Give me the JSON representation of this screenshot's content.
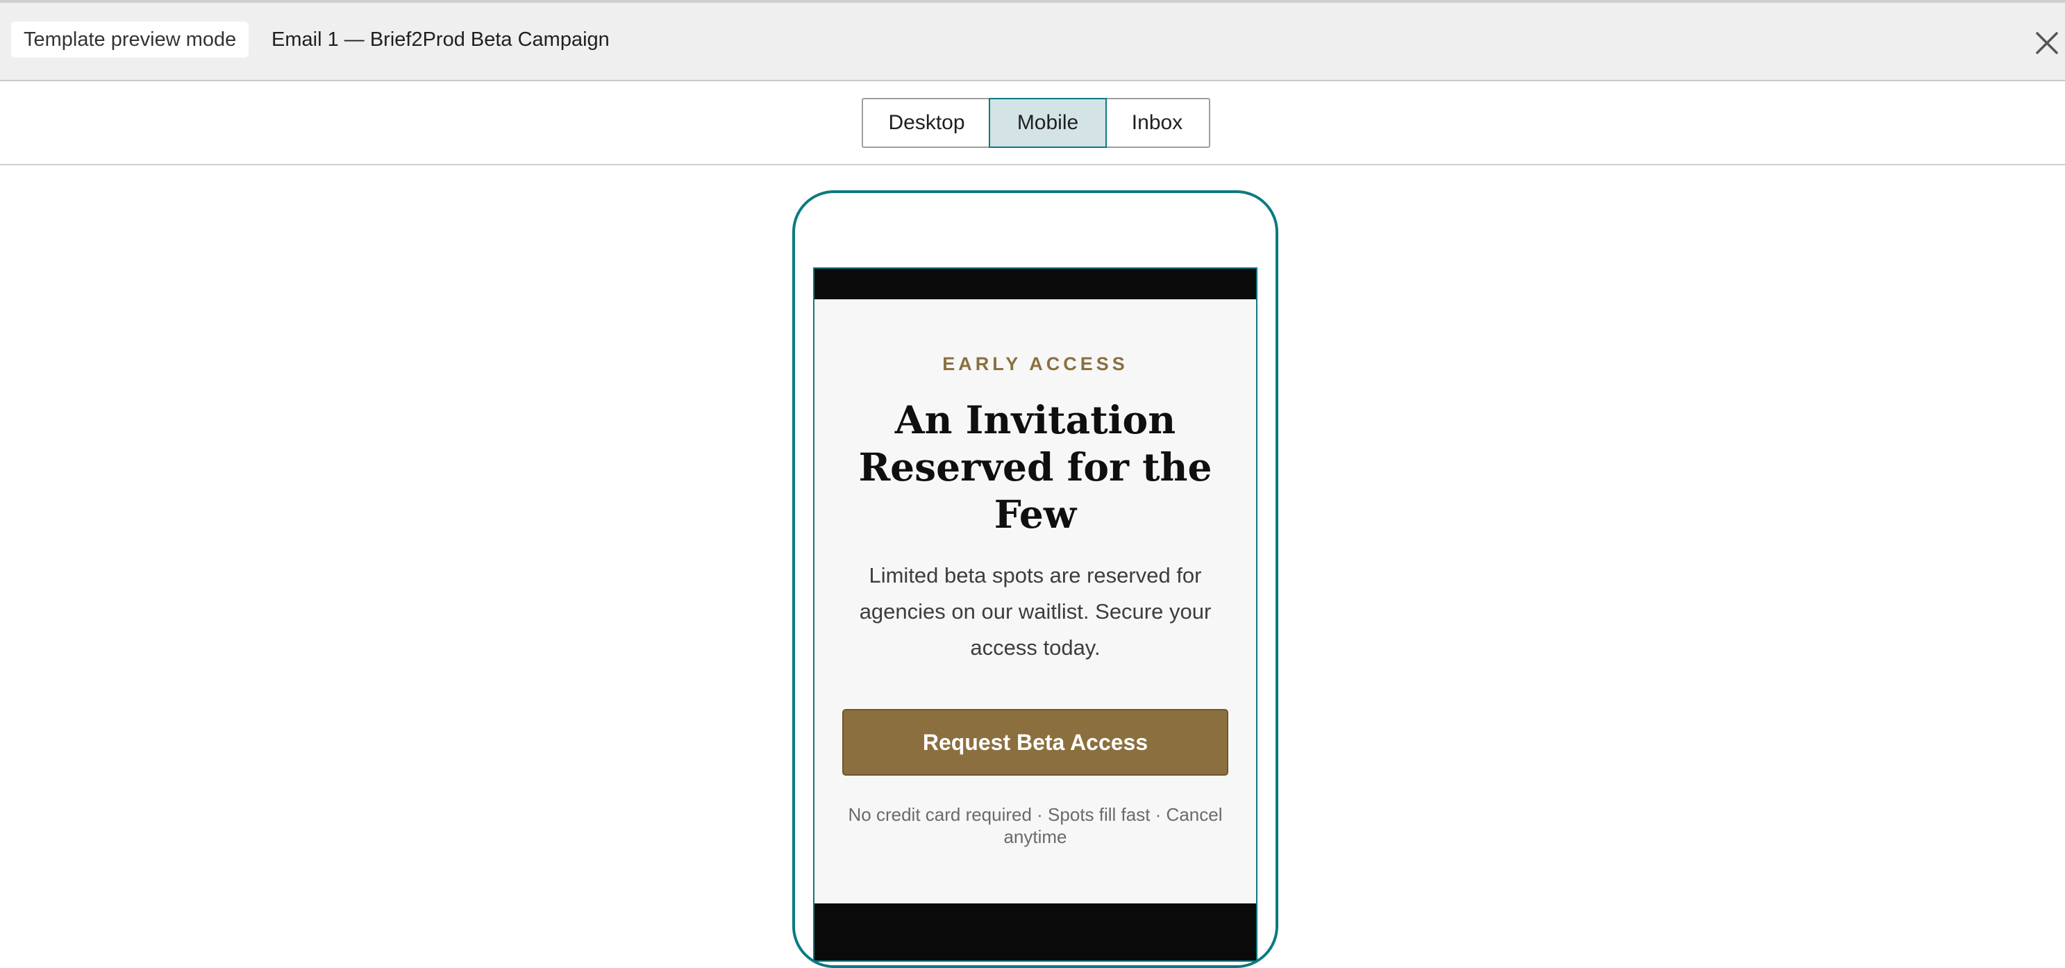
{
  "header": {
    "mode_label": "Template preview mode",
    "email_title": "Email 1 — Brief2Prod Beta Campaign",
    "close_icon": "close-icon"
  },
  "tabs": {
    "items": [
      {
        "label": "Desktop",
        "active": false
      },
      {
        "label": "Mobile",
        "active": true
      },
      {
        "label": "Inbox",
        "active": false
      }
    ]
  },
  "email": {
    "eyebrow": "EARLY ACCESS",
    "headline": "An Invitation Reserved for the Few",
    "body": "Limited beta spots are reserved for agencies on our waitlist. Secure your access today.",
    "cta_label": "Request Beta Access",
    "fineprint": "No credit card required · Spots fill fast · Cancel anytime"
  },
  "colors": {
    "accent_teal": "#0b7a82",
    "gold": "#8b6f3e",
    "header_bg": "#efefef",
    "email_bg": "#f7f7f7",
    "email_band": "#0a0a0a"
  }
}
